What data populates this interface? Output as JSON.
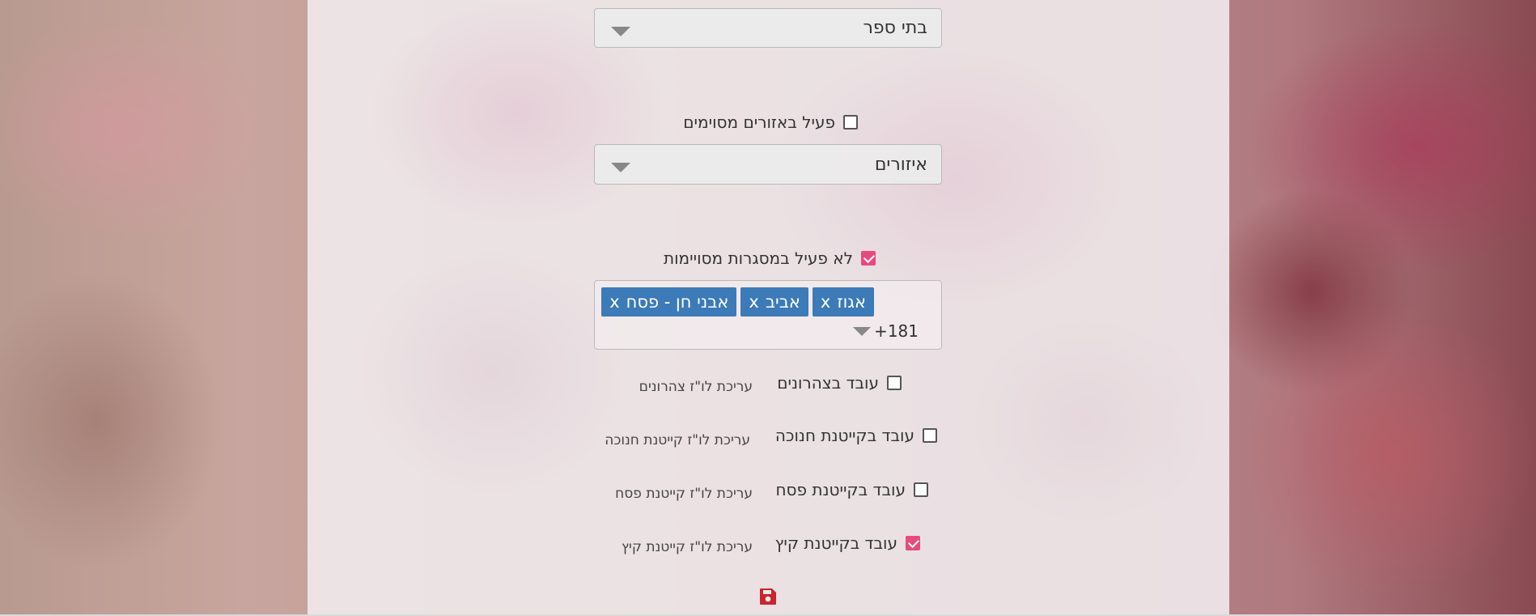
{
  "schools_select": {
    "value": "בתי ספר"
  },
  "areas_toggle": {
    "label": "פעיל באזורים מסוימים",
    "checked": false
  },
  "areas_select": {
    "value": "איזורים"
  },
  "frameworks_toggle": {
    "label": "לא פעיל במסגרות מסויימות",
    "checked": true
  },
  "frameworks_multiselect": {
    "chips": [
      {
        "label": "אגוז",
        "remove": "x"
      },
      {
        "label": "אביב",
        "remove": "x"
      },
      {
        "label": "אבני חן - פסח",
        "remove": "x"
      }
    ],
    "more_count": "181+"
  },
  "work_options": [
    {
      "label": "עובד בצהרונים",
      "checked": false,
      "edit_link": "עריכת לו\"ז צהרונים"
    },
    {
      "label": "עובד בקייטנת חנוכה",
      "checked": false,
      "edit_link": "עריכת לו\"ז קייטנת חנוכה"
    },
    {
      "label": "עובד בקייטנת פסח",
      "checked": false,
      "edit_link": "עריכת לו\"ז קייטנת פסח"
    },
    {
      "label": "עובד בקייטנת קיץ",
      "checked": true,
      "edit_link": "עריכת לו\"ז קייטנת קיץ"
    }
  ],
  "colors": {
    "accent": "#e84a7f",
    "chip": "#3c7ab8",
    "save": "#c9252c"
  },
  "icons": {
    "save": "floppy-disk-icon"
  }
}
